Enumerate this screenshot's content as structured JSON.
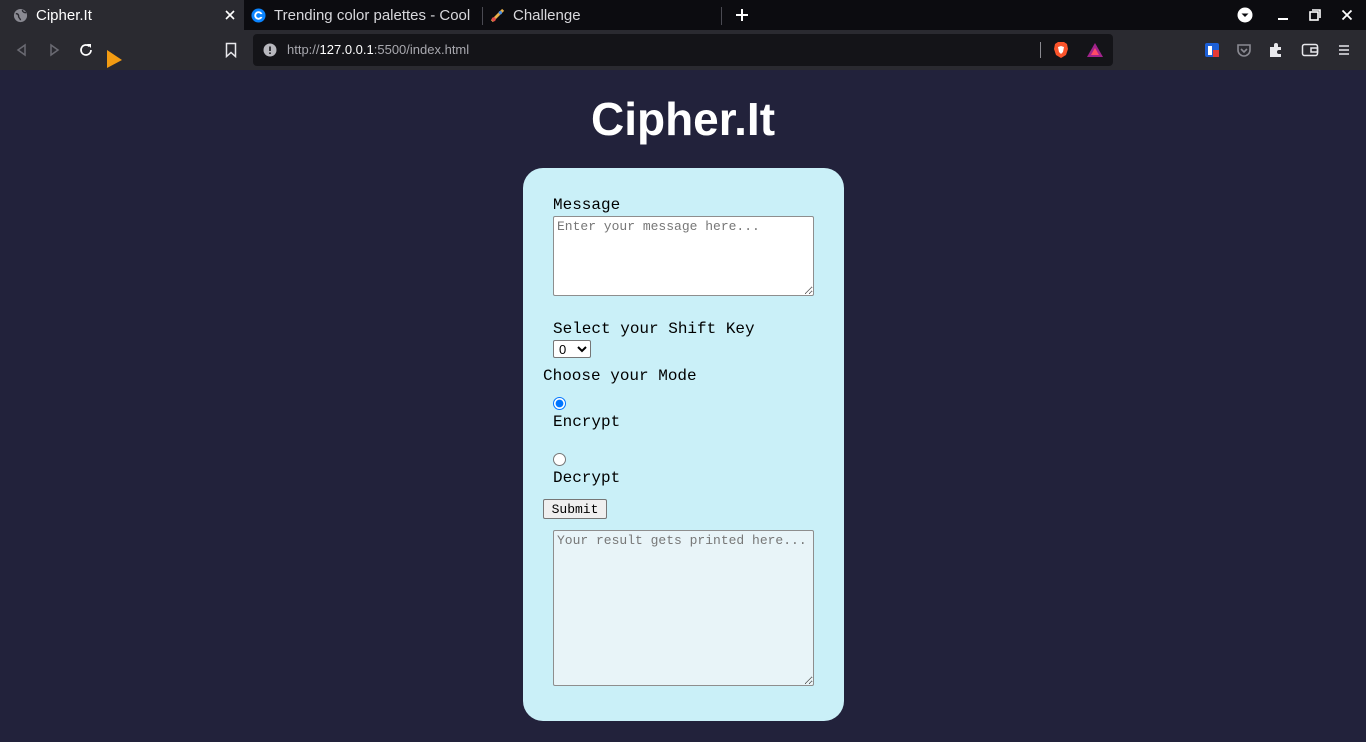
{
  "browser": {
    "tabs": [
      {
        "label": "Cipher.It",
        "active": true
      },
      {
        "label": "Trending color palettes - Cool"
      },
      {
        "label": "Challenge"
      }
    ],
    "url": {
      "scheme": "http://",
      "host": "127.0.0.1",
      "rest": ":5500/index.html"
    }
  },
  "app": {
    "title": "Cipher.It",
    "message_label": "Message",
    "message_placeholder": "Enter your message here...",
    "shift_label": "Select your Shift Key",
    "shift_selected": "0",
    "mode_label": "Choose your Mode",
    "mode_options": [
      {
        "label": "Encrypt",
        "checked": true
      },
      {
        "label": "Decrypt",
        "checked": false
      }
    ],
    "submit_label": "Submit",
    "result_placeholder": "Your result gets printed here..."
  },
  "colors": {
    "page_bg": "#22223b",
    "card_bg": "#caf0f8",
    "result_bg": "#e8f4f8"
  }
}
